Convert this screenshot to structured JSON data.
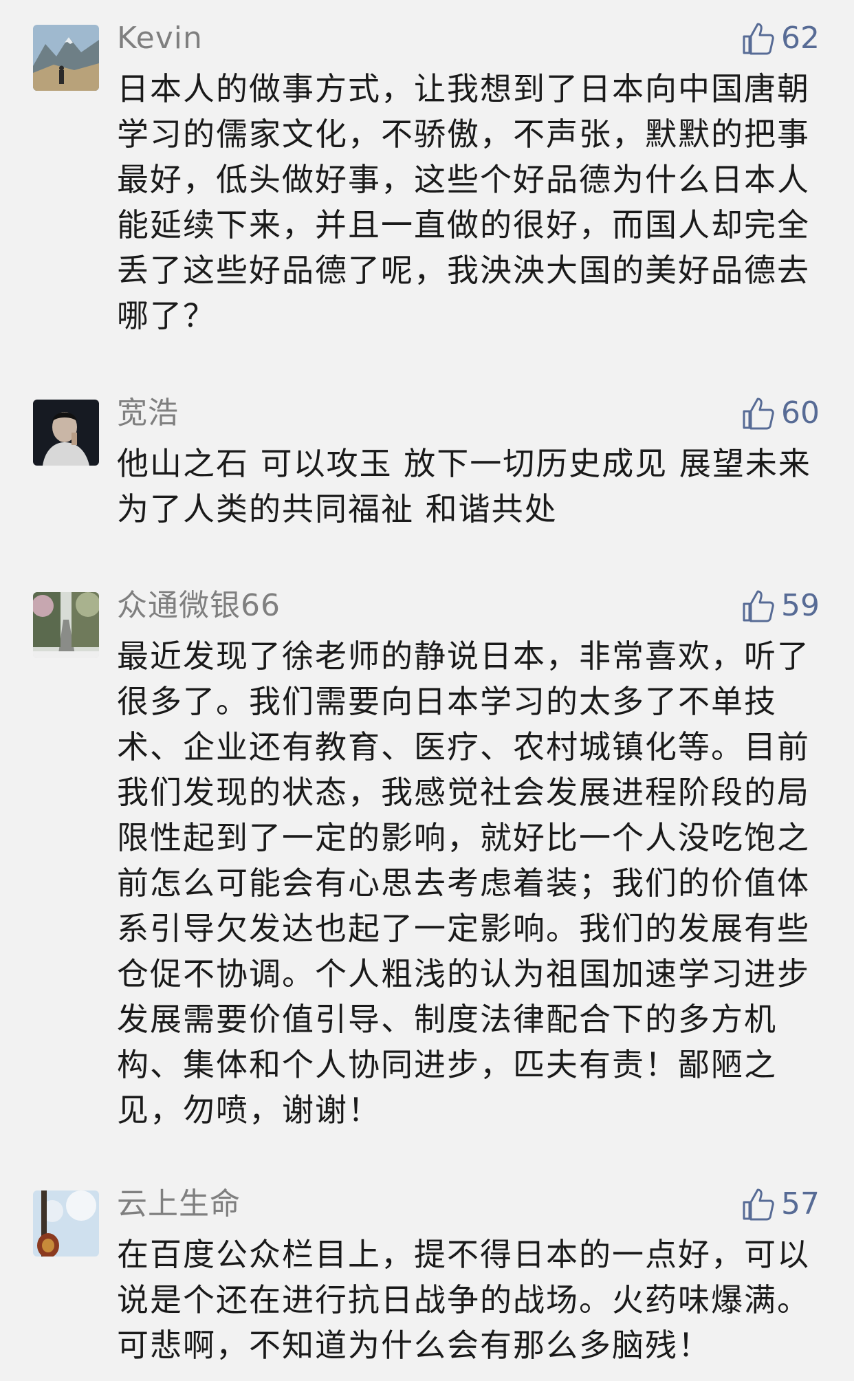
{
  "comments": [
    {
      "username": "Kevin",
      "likes": "62",
      "content": "日本人的做事方式，让我想到了日本向中国唐朝学习的儒家文化，不骄傲，不声张，默默的把事最好，低头做好事，这些个好品德为什么日本人能延续下来，并且一直做的很好，而国人却完全丢了这些好品德了呢，我泱泱大国的美好品德去哪了？",
      "avatar": "mountain-hiker-photo"
    },
    {
      "username": "宽浩",
      "likes": "60",
      "content": "他山之石 可以攻玉 放下一切历史成见 展望未来 为了人类的共同福祉 和谐共处",
      "avatar": "man-portrait-photo"
    },
    {
      "username": "众通微银66",
      "likes": "59",
      "content": "最近发现了徐老师的静说日本，非常喜欢，听了很多了。我们需要向日本学习的太多了不单技术、企业还有教育、医疗、农村城镇化等。目前我们发现的状态，我感觉社会发展进程阶段的局限性起到了一定的影响，就好比一个人没吃饱之前怎么可能会有心思去考虑着装；我们的价值体系引导欠发达也起了一定影响。我们的发展有些仓促不协调。个人粗浅的认为祖国加速学习进步发展需要价值引导、制度法律配合下的多方机构、集体和个人协同进步，匹夫有责！鄙陋之见，勿喷，谢谢！",
      "avatar": "tree-road-photo"
    },
    {
      "username": "云上生命",
      "likes": "57",
      "content": "在百度公众栏目上，提不得日本的一点好，可以说是个还在进行抗日战争的战场。火药味爆满。可悲啊，不知道为什么会有那么多脑残！",
      "avatar": "guitar-sky-photo"
    }
  ],
  "colors": {
    "background": "#f2f2f2",
    "username": "#7f7f7f",
    "like_accent": "#576b95",
    "content_text": "#1a1a1a"
  },
  "icons": {
    "like": "thumbs-up-icon"
  }
}
